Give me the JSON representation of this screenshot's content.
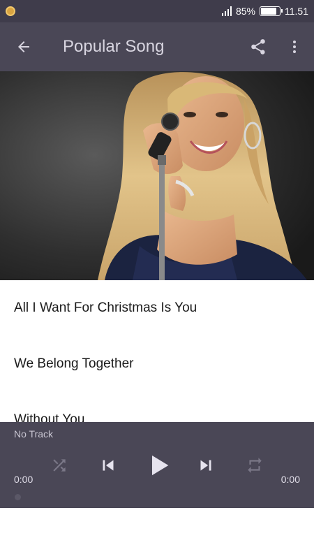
{
  "status_bar": {
    "battery_percent": "85%",
    "time": "11.51",
    "battery_level": 0.85,
    "icons": [
      "notification-icon",
      "signal-icon",
      "battery-icon"
    ]
  },
  "app_bar": {
    "title": "Popular Song",
    "icons": [
      "arrow-left-icon",
      "share-icon",
      "more-vert-icon"
    ]
  },
  "hero": {
    "icon": "singer-photo"
  },
  "songs": [
    {
      "title": "All I Want For Christmas Is You"
    },
    {
      "title": "We Belong Together"
    },
    {
      "title": "Without You"
    }
  ],
  "player": {
    "track": "No Track",
    "current_time": "0:00",
    "total_time": "0:00",
    "icons": [
      "shuffle-icon",
      "skip-previous-icon",
      "play-icon",
      "skip-next-icon",
      "repeat-icon"
    ],
    "colors": {
      "background": "#4a4756",
      "disabled_icon": "#7a7787",
      "active_icon": "#e6e3ee"
    }
  },
  "colors": {
    "status_bar": "#3f3c4b",
    "app_bar": "#4a4756",
    "title_text": "#d8d5e0"
  }
}
